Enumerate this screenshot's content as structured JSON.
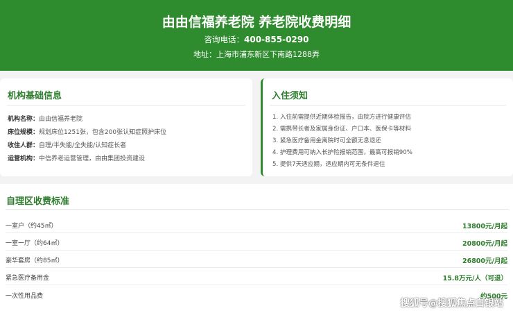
{
  "header": {
    "title": "由由信福养老院 养老院收费明细",
    "phone_label": "咨询电话：",
    "phone": "400-855-0290",
    "address": "地址：上海市浦东新区下南路1288弄"
  },
  "basic_info": {
    "title": "机构基础信息",
    "rows": [
      {
        "key": "机构名称：",
        "value": "由由信福养老院"
      },
      {
        "key": "床位规模：",
        "value": "规划床位1251张，包含200张认知症照护床位"
      },
      {
        "key": "收住人群：",
        "value": "自理/半失能/全失能/认知症长者"
      },
      {
        "key": "运营机构：",
        "value": "中信养老运营管理，由由集团投资建设"
      }
    ]
  },
  "notice": {
    "title": "入住须知",
    "items": [
      "1. 入住前需提供近期体检报告，由院方进行健康评估",
      "2. 需携带长者及家属身份证、户口本、医保卡等材料",
      "3. 紧急医疗备用金离院时可全额无息退还",
      "4. 护理费用可纳入长护险报销范围，最高可报销90%",
      "5. 提供7天适应期，适应期内可无条件退住"
    ]
  },
  "fees": {
    "title": "自理区收费标准",
    "rows": [
      {
        "name": "一室户（约45㎡）",
        "price": "13800元/月起"
      },
      {
        "name": "一室一厅（约64㎡）",
        "price": "20800元/月起"
      },
      {
        "name": "豪华套房（约85㎡）",
        "price": "26800元/月起"
      },
      {
        "name": "紧急医疗备用金",
        "price": "15.8万元/人（可退）"
      },
      {
        "name": "一次性用品费",
        "price": "约500元"
      }
    ]
  },
  "watermark": "搜狐号@搜狐焦点白银站"
}
